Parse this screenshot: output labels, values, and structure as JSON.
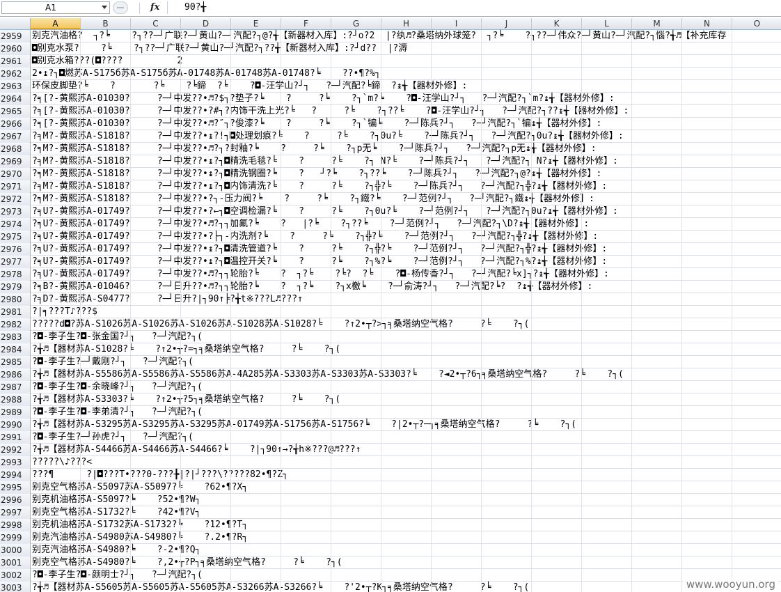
{
  "formula_bar": {
    "name_box": "A1",
    "fx_label": "fx",
    "formula": "90?╅"
  },
  "columns": [
    "A",
    "B",
    "C",
    "D",
    "E",
    "F",
    "G",
    "H",
    "I",
    "J",
    "K",
    "L",
    "M",
    "N",
    "O"
  ],
  "selected_column": "A",
  "rows": [
    {
      "n": "2959",
      "t": "别克汽油格?  ┐?╘    ?┐??─┘广联?─┘黄山?─┘汽配?┐@?╅【新器材入库】:?┘o?2  |?纨♬?桑塔纳外球笼?  ┐?╘    ?┐??─┘伟众?─┘黄山?─┘汽配?┐惱?╅♬【补充库存"
    },
    {
      "n": "2960",
      "t": "◘别克水泵?    ?╘    ?┐??─┘广联?─┘黄山?─┘汽配?┐??╅【新器材入库】:?┘d??  |?溽"
    },
    {
      "n": "2961",
      "t": "◘别克水箱???(◘????          2"
    },
    {
      "n": "2962",
      "t": "2•↨?┐◘燃苏A-S175б苏A-S175б苏A-01748苏A-01748苏A-01748?╘    ??•¶?%┐"
    },
    {
      "n": "2963",
      "t": "环保皮脚垫?╘    ?       ?╘    ?╘鍗  ?╘    ?◘-汪学山?┘┐   ?─┘汽配?╘鍗  ?↨╅【器材外修】:"
    },
    {
      "n": "2964",
      "t": "?╕[?-黄熙苏A-01030?     ?─┘中发??•♬?$┐?垫子?╘    ?     ?╘    ?┐`m?╘    ?◘-汪学山?┘┐   ?─┘汽配?┐`m?↨╅【器材外修】:"
    },
    {
      "n": "2965",
      "t": "?╕[?-黄熙苏A-01030?     ?─┘中发??•?#┐?内饰干洗上光?╘   ?     ?╘    ?┐??╘    ?◘-汪学山?┘┐   ?─┘汽配?┐??↨╅【器材外修】:"
    },
    {
      "n": "2966",
      "t": "?╕[?-黄熙苏A-01030?     ?─┘中发??•♬?″┐?俊漆?╘    ?     ?╘    ?┐`犏╘    ?─┘陈兵?┘┐   ?─┘汽配?┐`犏↨╅【器材外修】:"
    },
    {
      "n": "2967",
      "t": "?╕M?-黄熙苏A-S1818?     ?─┘中发??•↨?!┐◘处理划痕?╘    ?     ?╘    ?┐0u?╘    ?─┘陈兵?┘┐   ?─┘汽配?┐0u?↨╅【器材外修】:"
    },
    {
      "n": "2968",
      "t": "?╕M?-黄熙苏A-S1818?     ?─┘中发??•♬?┐?封釉?╘    ?     ?╘    ?┐p无╘    ?─┘陈兵?┘┐   ?─┘汽配?┐p无↨╅【器材外修】:"
    },
    {
      "n": "2969",
      "t": "?╕M?-黄熙苏A-S1818?     ?─┘中发??•↨?┐◘精洗毛毯?╘    ?     ?╘    ?┐ N?╘    ?─┘陈兵?┘┐   ?─┘汽配?┐ N?↨╅【器材外修】:"
    },
    {
      "n": "2970",
      "t": "?╕M?-黄熙苏A-S1818?     ?─┘中发??•↨?┐◘精洗钢圈?╘    ?   ┘?╘    ?┐??╘    ?─┘陈兵?┘┐   ?─┘汽配?┐@?↨╅【器材外修】:"
    },
    {
      "n": "2971",
      "t": "?╕M?-黄熙苏A-S1818?     ?─┘中发??•↨?┐◘内饰清洗?╘    ?     ?╘    ?┐╬?╘    ?─┘陈兵?┘┐   ?─┘汽配?┐╬?↨╅【器材外修】:"
    },
    {
      "n": "2972",
      "t": "?╕M?-黄熙苏A-S1818?     ?─┘中发??•?┐-压力阀?╘    ?     ?╘    ?┐鐵?╘    ?─┘范例?┘┐   ?─┘汽配?┐鐵↨╅【器材外修】:"
    },
    {
      "n": "2973",
      "t": "?╕U?-黄熙苏A-01749?     ?─┘中发??•?←┐◘空调检漏?╘    ?     ?╘    ?┐0u?╘    ?─┘范例?┘┐   ?─┘汽配?┐0u?↨╅【器材外修】:"
    },
    {
      "n": "2974",
      "t": "?╕U?-黄熙苏A-01749?     ?─┘中发??•♬?┐┐加氟?╘    ?   |?╘    ?┐??╘    ?─┘范例?┘┐   ?─┘汽配?┐\\D?↨╅【器材外修】:"
    },
    {
      "n": "2975",
      "t": "?╕U?-黄熙苏A-01749?     ?─┘中发??•?├┐-内洗剂?╘    ?     ?╘    ?┐╬?╘    ?─┘范例?┘┐   ?─┘汽配?┐╬?↨╅【器材外修】:"
    },
    {
      "n": "2976",
      "t": "?╕U?-黄熙苏A-01749?     ?─┘中发??•↨?┐◘清洗管道?╘    ?     ?╘    ?┐╬?╘    ?─┘范例?┘┐   ?─┘汽配?┐╬?↨╅【器材外修】:"
    },
    {
      "n": "2977",
      "t": "?╕U?-黄熙苏A-01749?     ?─┘中发??•↨?┐◘温控开关?╘    ?     ?╘    ?┐%?╘    ?─┘范例?┘┐   ?─┘汽配?┐%?↨╅【器材外修】:"
    },
    {
      "n": "2978",
      "t": "?╕U?-黄熙苏A-01749?     ?─┘中发??•♬?┐┐轮胎?╘    ?  ┐?╘    ?╘?  ?╘    ?◘-杨传香?┘┐   ?─┘汽配?╘x]┐?↨╅【器材外修】:"
    },
    {
      "n": "2979",
      "t": "?╕B?-黄熙苏A-01046?     ?─┘日升??•♬?┐┐轮胎?╘    ?  ┐?╘    ?┐x檄╘    ?─┘俞涛?┘┐   ?─┘汽配?╘?  ?↨╅【器材外修】:"
    },
    {
      "n": "2980",
      "t": "?╕D?-黄熙苏A-S0477?     ?─┘日升?|┐90↑╞?╅t※???L♬???↑"
    },
    {
      "n": "2981",
      "t": "?|╕???T♪???$"
    },
    {
      "n": "2982",
      "t": "?????d◘?苏A-S1026苏A-S1026苏A-S1026苏A-S1028苏A-S1028?╘    ?↑2•┬?>┐╕桑塔纳空气格?     ?╘    ?┐("
    },
    {
      "n": "2983",
      "t": "?◘-李子生?◘-张金国?┘┐   ?─┘汽配?┐("
    },
    {
      "n": "2984",
      "t": "?╅♬【器材苏A-S1028?╘    ?↑2•┬?=┐╕桑塔纳空气格?     ?╘    ?┐("
    },
    {
      "n": "2985",
      "t": "?◘-李子生?─┘戴刚?┘┐   ?─┘汽配?┐("
    },
    {
      "n": "2986",
      "t": "?╅♬【器材苏A-S5586苏A-S5586苏A-S5586苏A-4A285苏A-S3303苏A-S3303苏A-S3303?╘    ?◄2•┬?6┐╕桑塔纳空气格?     ?╘    ?┐("
    },
    {
      "n": "2987",
      "t": "?◘-李子生?◘-余晓峰?┘┐   ?─┘汽配?┐("
    },
    {
      "n": "2988",
      "t": "?╅♬【器材苏A-S3303?╘    ?↑2•┬?5┐╕桑塔纳空气格?     ?╘    ?┐("
    },
    {
      "n": "2989",
      "t": "?◘-李子生?◘-李弟清?┘┐   ?─┘汽配?┐("
    },
    {
      "n": "2990",
      "t": "?╅♬【器材苏A-S3295苏A-S3295苏A-S3295苏A-01749苏A-S1756苏A-S1756?╘    ?|2•┬?─┐╕桑塔纳空气格?     ?╘    ?┐("
    },
    {
      "n": "2991",
      "t": "?◘-李子生?─┘孙虎?┘┐   ?─┘汽配?┐("
    },
    {
      "n": "2992",
      "t": "?╅♬【器材苏A-S4466苏A-S4466苏A-S4466?╘    ?|┐90↑→?╅h※???@♬???↑"
    },
    {
      "n": "2993",
      "t": "?????\\♪???<"
    },
    {
      "n": "2994",
      "t": "???¶      ?|◘???T•???0-???╊|?|┘???\\?????82•¶?Z┐"
    },
    {
      "n": "2995",
      "t": "别克空气格苏A-S5097苏A-S5097?╘    ?62•¶?X┐"
    },
    {
      "n": "2996",
      "t": "别克机油格苏A-S5097?╘    ?52•¶?W┐"
    },
    {
      "n": "2997",
      "t": "别克空气格苏A-S1732?╘    ?42•¶?V┐"
    },
    {
      "n": "2998",
      "t": "别克机油格苏A-S1732苏A-S1732?╘    ?12•¶?T┐"
    },
    {
      "n": "2999",
      "t": "别克汽油格苏A-S4980苏A-S4980?╘    ?.2•¶?R┐"
    },
    {
      "n": "3000",
      "t": "别克汽油格苏A-S4980?╘    ?-2•¶?Q┐"
    },
    {
      "n": "3001",
      "t": "别克空气格苏A-S4980?╘    ?,2•┬?P┐╕桑塔纳空气格?     ?╘    ?┐("
    },
    {
      "n": "3002",
      "t": "?◘-李子生?◘-颜明士?┘┐   ?─┘汽配?┐("
    },
    {
      "n": "3003",
      "t": "?╅♬【器材苏A-S5605苏A-S5605苏A-S5605苏A-S3266苏A-S3266?╘    ?'2•┬?K┐╕桑塔纳空气格?     ?╘    ?┐("
    }
  ],
  "watermark": "www.wooyun.org"
}
